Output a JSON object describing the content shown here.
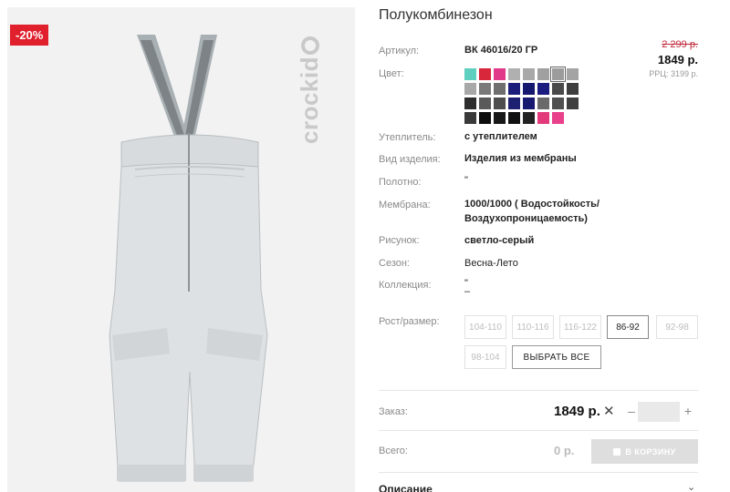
{
  "product": {
    "title": "Полукомбинезон",
    "discount_badge": "-20%",
    "brand": "crockid"
  },
  "price": {
    "old": "2 299 р.",
    "current": "1849 р.",
    "rrp": "РРЦ: 3199 р."
  },
  "specs": {
    "article_label": "Артикул:",
    "article_value": "ВК 46016/20 ГР",
    "color_label": "Цвет:",
    "insulation_label": "Утеплитель:",
    "insulation_value": "с утеплителем",
    "type_label": "Вид изделия:",
    "type_value": "Изделия из мембраны",
    "fabric_label": "Полотно:",
    "fabric_value": "\"",
    "membrane_label": "Мембрана:",
    "membrane_value_1": "1000/1000 ( Водостойкость/",
    "membrane_value_2": "Воздухопроницаемость)",
    "pattern_label": "Рисунок:",
    "pattern_value": "светло-серый",
    "season_label": "Сезон:",
    "season_value": "Весна-Лето",
    "collection_label": "Коллекция:",
    "collection_value_1": "\"",
    "collection_value_2": "–",
    "size_label": "Рост/размер:"
  },
  "swatches": [
    "#5fcfc0",
    "#d8263a",
    "#e23a8a",
    "#b0b0b0",
    "#a8a8a8",
    "#a0a0a0",
    "#9c9c9c",
    "#a4a4a4",
    "#a8a8a8",
    "#7a7a7a",
    "#6e6e6e",
    "#1b1d7a",
    "#161870",
    "#1a1c80",
    "#4a4a4a",
    "#3e3e3e",
    "#2e2e2e",
    "#5a5a5a",
    "#4e4e4e",
    "#1d1f70",
    "#171971",
    "#6a6a6a",
    "#505050",
    "#404040",
    "#3a3a3a",
    "#0e0e0e",
    "#181818",
    "#111111",
    "#222222",
    "#e23a7a",
    "#e8408a"
  ],
  "sizes": [
    {
      "label": "104-110",
      "active": false
    },
    {
      "label": "110-116",
      "active": false
    },
    {
      "label": "116-122",
      "active": false
    },
    {
      "label": "86-92",
      "active": true
    },
    {
      "label": "92-98",
      "active": false
    },
    {
      "label": "98-104",
      "active": false
    }
  ],
  "select_all_label": "ВЫБРАТЬ ВСЕ",
  "order": {
    "label": "Заказ:",
    "price": "1849 р.",
    "times_symbol": "✕",
    "minus": "–",
    "plus": "+",
    "quantity": ""
  },
  "total": {
    "label": "Всего:",
    "value": "0 р.",
    "cart_button": "В КОРЗИНУ"
  },
  "description": {
    "title": "Описание",
    "chevron": "⌄"
  }
}
